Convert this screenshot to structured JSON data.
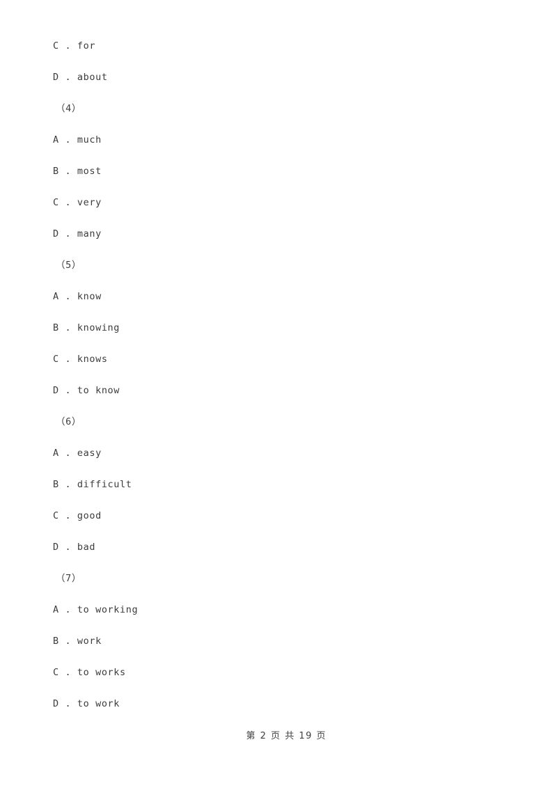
{
  "document": {
    "page_background": "#ffffff",
    "text_color": "#3c3c3c",
    "blocks": [
      {
        "kind": "options-tail",
        "options": [
          {
            "letter": "C",
            "sep": " . ",
            "text": "for"
          },
          {
            "letter": "D",
            "sep": " . ",
            "text": "about"
          }
        ]
      },
      {
        "kind": "question",
        "number": "（4）",
        "options": [
          {
            "letter": "A",
            "sep": " . ",
            "text": "much"
          },
          {
            "letter": "B",
            "sep": " . ",
            "text": "most"
          },
          {
            "letter": "C",
            "sep": " . ",
            "text": "very"
          },
          {
            "letter": "D",
            "sep": " . ",
            "text": "many"
          }
        ]
      },
      {
        "kind": "question",
        "number": "（5）",
        "options": [
          {
            "letter": "A",
            "sep": " . ",
            "text": "know"
          },
          {
            "letter": "B",
            "sep": " . ",
            "text": "knowing"
          },
          {
            "letter": "C",
            "sep": " . ",
            "text": "knows"
          },
          {
            "letter": "D",
            "sep": " . ",
            "text": "to know"
          }
        ]
      },
      {
        "kind": "question",
        "number": "（6）",
        "options": [
          {
            "letter": "A",
            "sep": " . ",
            "text": "easy"
          },
          {
            "letter": "B",
            "sep": " . ",
            "text": "difficult"
          },
          {
            "letter": "C",
            "sep": " . ",
            "text": "good"
          },
          {
            "letter": "D",
            "sep": " . ",
            "text": "bad"
          }
        ]
      },
      {
        "kind": "question",
        "number": "（7）",
        "options": [
          {
            "letter": "A",
            "sep": " . ",
            "text": "to working"
          },
          {
            "letter": "B",
            "sep": " . ",
            "text": "work"
          },
          {
            "letter": "C",
            "sep": " . ",
            "text": "to works"
          },
          {
            "letter": "D",
            "sep": " . ",
            "text": "to work"
          }
        ]
      }
    ]
  },
  "footer": {
    "prefix": "第",
    "current_page": "2",
    "page_unit_1": "页",
    "joiner": "共",
    "total_pages": "19",
    "page_unit_2": "页",
    "full_text": "第 2 页 共 19 页"
  }
}
